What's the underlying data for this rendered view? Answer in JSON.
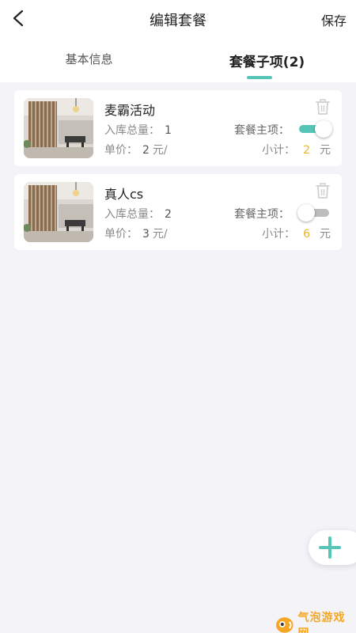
{
  "nav": {
    "title": "编辑套餐",
    "save_label": "保存"
  },
  "tabs": [
    {
      "label": "基本信息",
      "active": false
    },
    {
      "label": "套餐子项(2)",
      "active": true
    }
  ],
  "labels": {
    "stock_total": "入库总量：",
    "unit_price": "单价：",
    "currency_per": "元/",
    "main_item": "套餐主项：",
    "subtotal": "小计：",
    "currency": "元"
  },
  "items": [
    {
      "name": "麦霸活动",
      "stock_total": "1",
      "unit_price": "2",
      "is_main": true,
      "subtotal": "2"
    },
    {
      "name": "真人cs",
      "stock_total": "2",
      "unit_price": "3",
      "is_main": false,
      "subtotal": "6"
    }
  ],
  "colors": {
    "accent": "#56c5b8",
    "subtotal_amount": "#f0b323",
    "background": "#f4f4f8"
  },
  "watermark": {
    "text": "气泡游戏网"
  }
}
